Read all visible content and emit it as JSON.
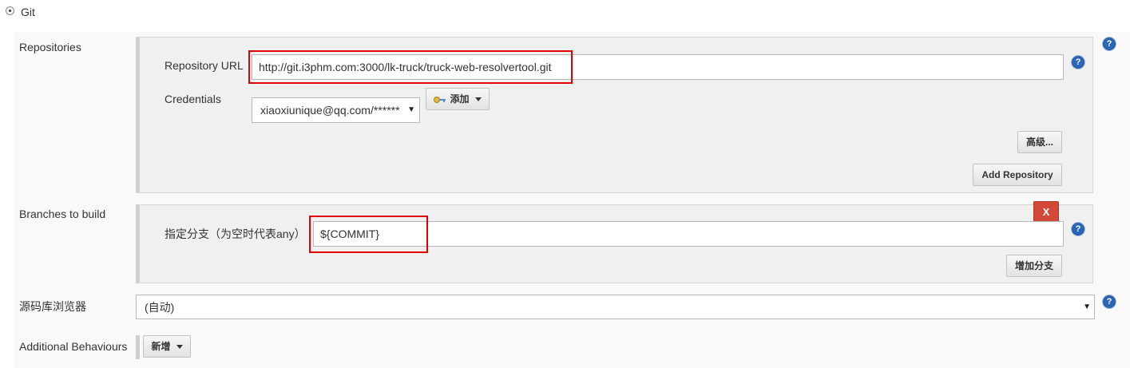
{
  "scm": {
    "option_label": "Git"
  },
  "repositories": {
    "section_label": "Repositories",
    "url_label": "Repository URL",
    "url_value": "http://git.i3phm.com:3000/lk-truck/truck-web-resolvertool.git",
    "credentials_label": "Credentials",
    "credentials_value": "xiaoxiunique@qq.com/******",
    "add_credentials_label": "添加",
    "advanced_label": "高级...",
    "add_repository_label": "Add Repository"
  },
  "branches": {
    "section_label": "Branches to build",
    "specifier_label": "指定分支（为空时代表any）",
    "specifier_value": "${COMMIT}",
    "delete_label": "X",
    "add_branch_label": "增加分支"
  },
  "browser": {
    "label": "源码库浏览器",
    "selected": "(自动)"
  },
  "behaviours": {
    "label": "Additional Behaviours",
    "add_label": "新增"
  },
  "icons": {
    "help": "help-icon",
    "key": "key-icon",
    "dropdown": "chevron-down-icon",
    "radio": "radio-selected-icon"
  },
  "colors": {
    "highlight": "#e00000",
    "help_blue": "#2a66b8",
    "delete_red": "#d24939"
  }
}
